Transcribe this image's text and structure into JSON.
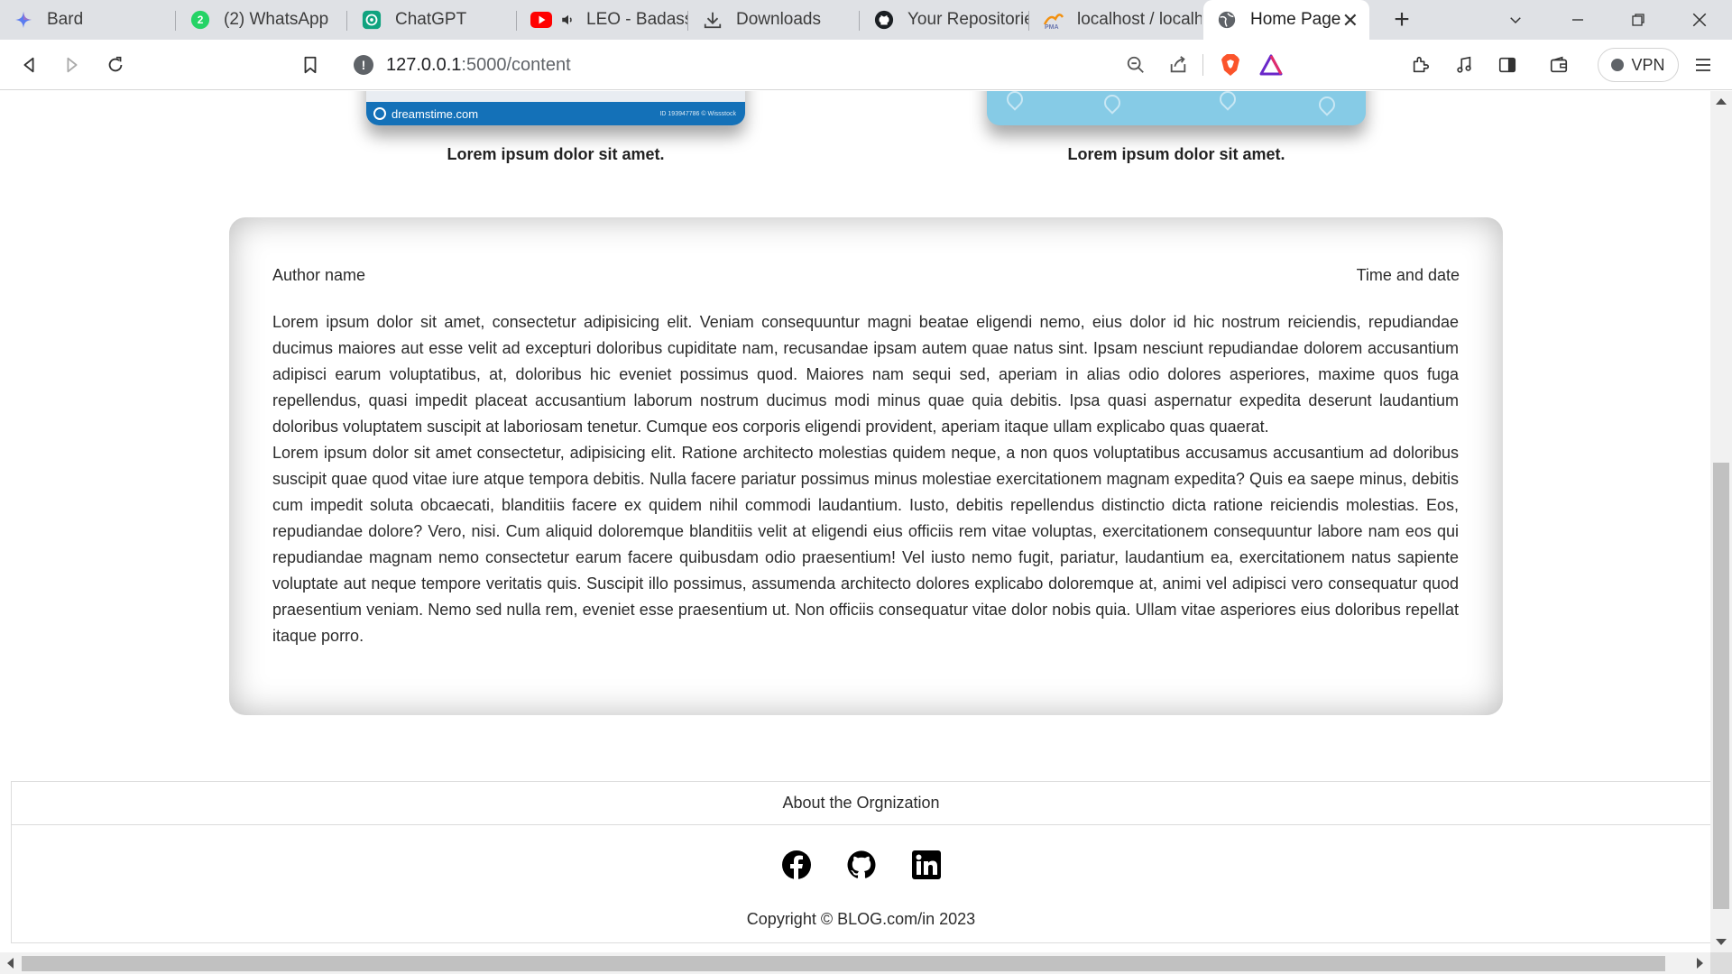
{
  "browser": {
    "tabs": [
      {
        "label": "Bard",
        "icon": "bard-sparkle-icon"
      },
      {
        "label": "(2) WhatsApp",
        "icon": "whatsapp-icon",
        "badge": "2"
      },
      {
        "label": "ChatGPT",
        "icon": "chatgpt-icon"
      },
      {
        "label": "LEO - Badass",
        "icon": "youtube-icon",
        "audio": true
      },
      {
        "label": "Downloads",
        "icon": "download-icon"
      },
      {
        "label": "Your Repositories",
        "icon": "github-icon"
      },
      {
        "label": "localhost / localhost",
        "icon": "phpmyadmin-icon"
      },
      {
        "label": "Home Page",
        "icon": "globe-icon",
        "active": true
      }
    ],
    "url_host": "127.0.0.1",
    "url_path": ":5000/content",
    "vpn_label": "VPN",
    "colors": {
      "youtube": "#ff0000",
      "whatsapp": "#25d366",
      "chatgpt": "#10a37f",
      "brave": "#fb542b"
    }
  },
  "page": {
    "gallery": {
      "left_watermark": "dreamstime.com",
      "left_id": "ID 193947786 © Wissstock",
      "left_caption": "Lorem ipsum dolor sit amet.",
      "right_caption": "Lorem ipsum dolor sit amet."
    },
    "post": {
      "author": "Author name",
      "time": "Time and date",
      "paragraph1": "Lorem ipsum dolor sit amet, consectetur adipisicing elit. Veniam consequuntur magni beatae eligendi nemo, eius dolor id hic nostrum reiciendis, repudiandae ducimus maiores aut esse velit ad excepturi doloribus cupiditate nam, recusandae ipsam autem quae natus sint. Ipsam nesciunt repudiandae dolorem accusantium adipisci earum voluptatibus, at, doloribus hic eveniet possimus quod. Maiores nam sequi sed, aperiam in alias odio dolores asperiores, maxime quos fuga repellendus, quasi impedit placeat accusantium laborum nostrum ducimus modi minus quae quia debitis. Ipsa quasi aspernatur expedita deserunt laudantium doloribus voluptatem suscipit at laboriosam tenetur. Cumque eos corporis eligendi provident, aperiam itaque ullam explicabo quas quaerat.",
      "paragraph2": "Lorem ipsum dolor sit amet consectetur, adipisicing elit. Ratione architecto molestias quidem neque, a non quos voluptatibus accusamus accusantium ad doloribus suscipit quae quod vitae iure atque tempora debitis. Nulla facere pariatur possimus minus molestiae exercitationem magnam expedita? Quis ea saepe minus, debitis cum impedit soluta obcaecati, blanditiis facere ex quidem nihil commodi laudantium. Iusto, debitis repellendus distinctio dicta ratione reiciendis molestias. Eos, repudiandae dolore? Vero, nisi. Cum aliquid doloremque blanditiis velit at eligendi eius officiis rem vitae voluptas, exercitationem consequuntur labore nam eos qui repudiandae magnam nemo consectetur earum facere quibusdam odio praesentium! Vel iusto nemo fugit, pariatur, laudantium ea, exercitationem natus sapiente voluptate aut neque tempore veritatis quis. Suscipit illo possimus, assumenda architecto dolores explicabo doloremque at, animi vel adipisci vero consequatur quod praesentium veniam. Nemo sed nulla rem, eveniet esse praesentium ut. Non officiis consequatur vitae dolor nobis quia. Ullam vitae asperiores eius doloribus repellat itaque porro."
    },
    "footer": {
      "heading": "About the Orgnization",
      "social": [
        "facebook-icon",
        "github-icon",
        "linkedin-icon"
      ],
      "copyright": "Copyright © BLOG.com/in 2023"
    }
  }
}
